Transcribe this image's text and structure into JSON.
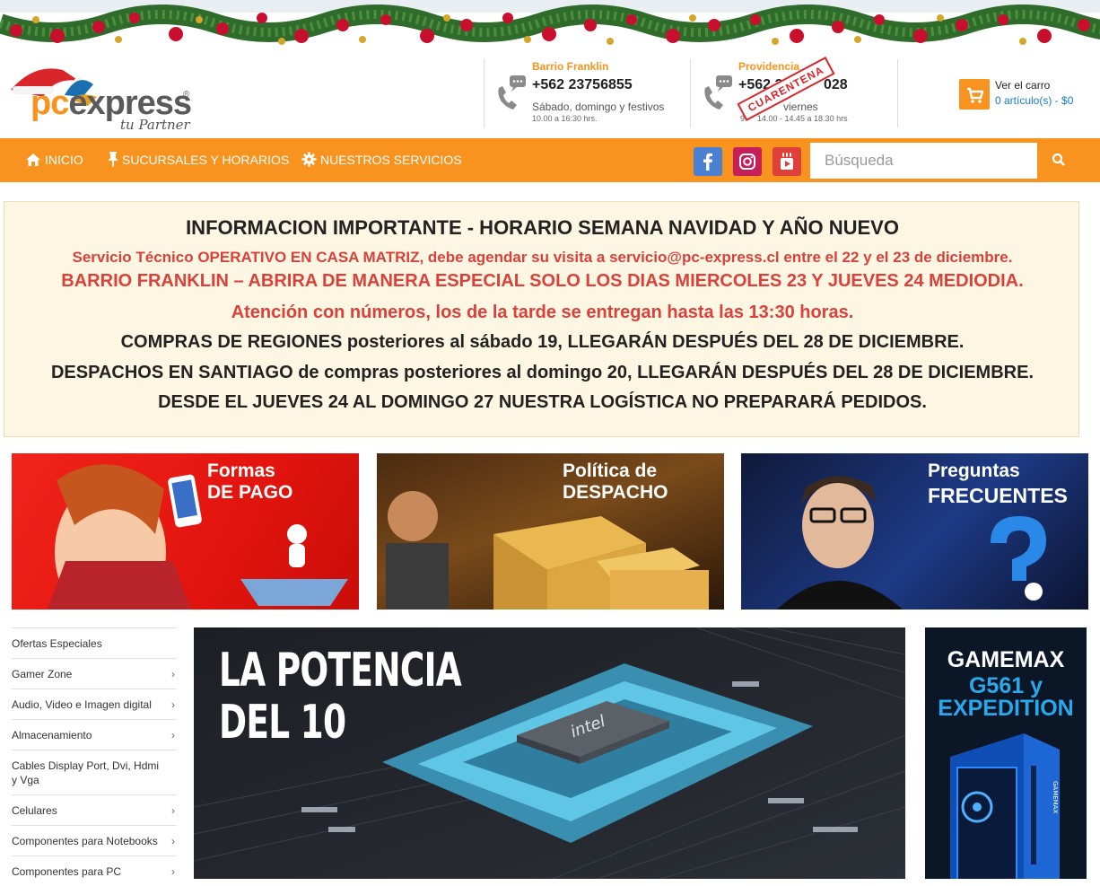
{
  "brand": {
    "name_pc": "pc",
    "name_express": "express",
    "reg": "®",
    "tagline": "tu Partner",
    "accent": "#f7931e"
  },
  "stores": [
    {
      "city": "Barrio Franklin",
      "phone": "+562 23756855",
      "days": "Sábado, domingo y festivos",
      "hours": "10.00 a 16:30 hrs."
    },
    {
      "city": "Providencia",
      "phone": "+562 2",
      "phone_end": "028",
      "days": "viernes",
      "hours_start": "9",
      "hours": "14.00 - 14.45 a 18.30 hrs"
    }
  ],
  "stamp": "CUARENTENA",
  "cart": {
    "title": "Ver el carro",
    "summary": "0 artículo(s) - $0"
  },
  "nav": {
    "items": [
      {
        "label": "Inicio",
        "icon": "home-icon"
      },
      {
        "label": "Sucursales y horarios",
        "icon": "pin-icon"
      },
      {
        "label": "Nuestros servicios",
        "icon": "gear-icon"
      }
    ],
    "social": [
      "facebook-icon",
      "instagram-icon",
      "youtube-icon"
    ],
    "search_placeholder": "Búsqueda"
  },
  "notice": {
    "title": "INFORMACION IMPORTANTE - HORARIO SEMANA NAVIDAD Y AÑO NUEVO",
    "line1": "Servicio Técnico OPERATIVO EN CASA MATRIZ, debe agendar su visita a servicio@pc-express.cl entre el 22 y el 23 de diciembre.",
    "line2": "BARRIO FRANKLIN – ABRIRA DE MANERA ESPECIAL SOLO LOS DIAS MIERCOLES 23 Y JUEVES 24 MEDIODIA.",
    "line3": "Atención con números, los de la tarde se entregan hasta las 13:30 horas.",
    "line4": "COMPRAS DE REGIONES posteriores al sábado 19, LLEGARÁN DESPUÉS DEL 28 DE DICIEMBRE.",
    "line5": "DESPACHOS EN SANTIAGO de compras posteriores al domingo 20, LLEGARÁN DESPUÉS DEL 28 DE DICIEMBRE.",
    "line6": "DESDE EL JUEVES 24 AL DOMINGO 27 NUESTRA LOGÍSTICA NO PREPARARÁ PEDIDOS."
  },
  "banners": [
    {
      "l1": "Formas",
      "l2": "DE PAGO"
    },
    {
      "l1": "Política de",
      "l2": "DESPACHO"
    },
    {
      "l1": "Preguntas",
      "l2": "FRECUENTES"
    }
  ],
  "categories": [
    {
      "label": "Ofertas Especiales",
      "chevron": ""
    },
    {
      "label": "Gamer Zone",
      "chevron": "›"
    },
    {
      "label": "Audio, Video e Imagen digital",
      "chevron": "›"
    },
    {
      "label": "Almacenamiento",
      "chevron": "›"
    },
    {
      "label": "Cables Display Port, Dvi, Hdmi y Vga",
      "chevron": ""
    },
    {
      "label": "Celulares",
      "chevron": "›"
    },
    {
      "label": "Componentes para Notebooks",
      "chevron": "›"
    },
    {
      "label": "Componentes para PC",
      "chevron": "›"
    }
  ],
  "hero": {
    "line1": "LA POTENCIA",
    "line2": "DEL 10",
    "chip": "intel"
  },
  "side": {
    "line1": "GAMEMAX",
    "line2": "G561 y",
    "line3": "EXPEDITION",
    "case_label": "GAMEMAX"
  }
}
